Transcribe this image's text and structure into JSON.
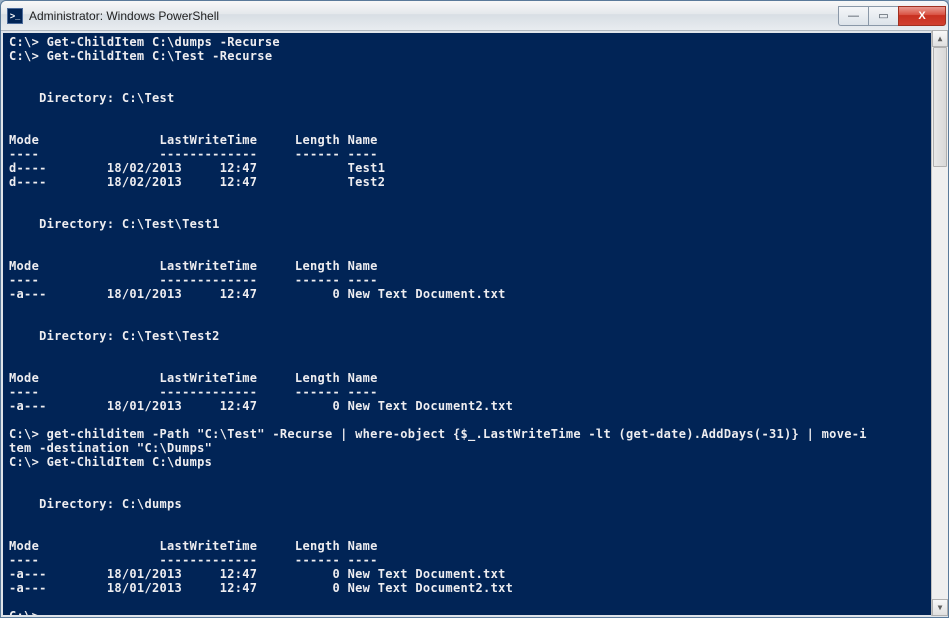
{
  "window": {
    "title": "Administrator: Windows PowerShell",
    "icon_text": ">_"
  },
  "controls": {
    "min": "—",
    "max": "▭",
    "close": "X"
  },
  "prompt": "C:\\>",
  "lines": {
    "cmd1": "C:\\> Get-ChildItem C:\\dumps -Recurse",
    "cmd2": "C:\\> Get-ChildItem C:\\Test -Recurse",
    "dir1": "    Directory: C:\\Test",
    "hdr": "Mode                LastWriteTime     Length Name",
    "sep": "----                -------------     ------ ----",
    "r1": "d----        18/02/2013     12:47            Test1",
    "r2": "d----        18/02/2013     12:47            Test2",
    "dir2": "    Directory: C:\\Test\\Test1",
    "r3": "-a---        18/01/2013     12:47          0 New Text Document.txt",
    "dir3": "    Directory: C:\\Test\\Test2",
    "r4": "-a---        18/01/2013     12:47          0 New Text Document2.txt",
    "cmd3a": "C:\\> get-childitem -Path \"C:\\Test\" -Recurse | where-object {$_.LastWriteTime -lt (get-date).AddDays(-31)} | move-i",
    "cmd3b": "tem -destination \"C:\\Dumps\"",
    "cmd4": "C:\\> Get-ChildItem C:\\dumps",
    "dir4": "    Directory: C:\\dumps",
    "r5": "-a---        18/01/2013     12:47          0 New Text Document.txt",
    "r6": "-a---        18/01/2013     12:47          0 New Text Document2.txt",
    "cmd5": "C:\\> "
  }
}
